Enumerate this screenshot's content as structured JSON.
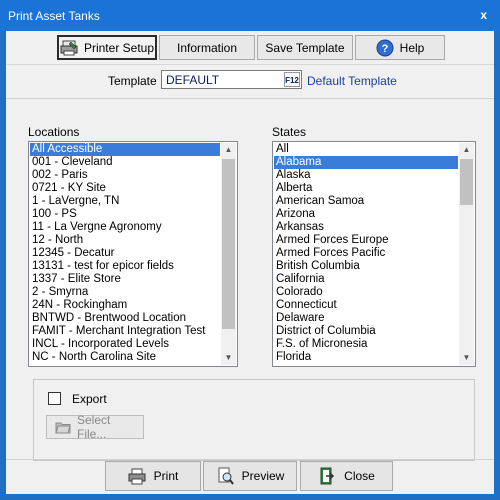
{
  "window": {
    "title": "Print Asset Tanks",
    "close_glyph": "x"
  },
  "toolbar": {
    "printer_setup": "Printer Setup",
    "information": "Information",
    "save_template": "Save Template",
    "help": "Help"
  },
  "template": {
    "label": "Template",
    "value": "DEFAULT",
    "f12": "F12",
    "description": "Default Template"
  },
  "locations": {
    "label": "Locations",
    "selected": "All Accessible",
    "items": [
      "All Accessible",
      "001 - Cleveland",
      "002 - Paris",
      "0721 - KY Site",
      "1 - LaVergne, TN",
      "100 - PS",
      "11 - La Vergne Agronomy",
      "12 - North",
      "12345 - Decatur",
      "13131 - test for epicor fields",
      "1337 - Elite Store",
      "2 - Smyrna",
      "24N - Rockingham",
      "BNTWD - Brentwood Location",
      "FAMIT - Merchant Integration Test",
      "INCL - Incorporated Levels",
      "NC - North Carolina Site"
    ]
  },
  "states": {
    "label": "States",
    "selected": "Alabama",
    "items": [
      "All",
      "Alabama",
      "Alaska",
      "Alberta",
      "American Samoa",
      "Arizona",
      "Arkansas",
      "Armed Forces Europe",
      "Armed Forces Pacific",
      "British Columbia",
      "California",
      "Colorado",
      "Connecticut",
      "Delaware",
      "District of Columbia",
      "F.S. of Micronesia",
      "Florida"
    ]
  },
  "export": {
    "label": "Export",
    "checked": false,
    "select_file": "Select File..."
  },
  "bottom": {
    "print": "Print",
    "preview": "Preview",
    "close": "Close"
  },
  "icons": {
    "printer_setup": "printer-setup-icon",
    "help": "help-icon",
    "select_file": "folder-icon",
    "print": "print-icon",
    "preview": "preview-icon",
    "close": "exit-icon"
  },
  "colors": {
    "titlebar": "#1a73d6",
    "selection": "#3a7dd8",
    "link_text": "#1a3ea8"
  }
}
